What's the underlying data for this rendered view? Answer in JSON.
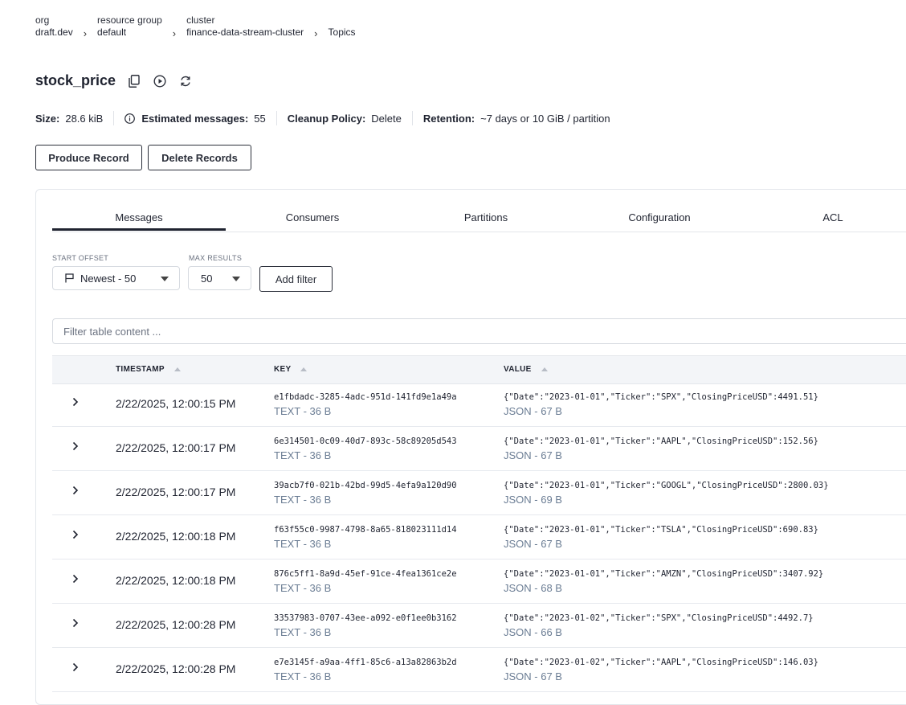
{
  "breadcrumb": {
    "segments": [
      {
        "label": "org",
        "value": "draft.dev"
      },
      {
        "label": "resource group",
        "value": "default"
      },
      {
        "label": "cluster",
        "value": "finance-data-stream-cluster"
      }
    ],
    "current": "Topics"
  },
  "topic": {
    "name": "stock_price",
    "icons": [
      "copy-icon",
      "play-icon",
      "refresh-icon"
    ]
  },
  "stats": {
    "size_label": "Size:",
    "size_value": "28.6 kiB",
    "messages_label": "Estimated messages:",
    "messages_value": "55",
    "cleanup_label": "Cleanup Policy:",
    "cleanup_value": "Delete",
    "retention_label": "Retention:",
    "retention_value": "~7 days or 10 GiB / partition"
  },
  "actions": {
    "produce": "Produce Record",
    "delete": "Delete Records"
  },
  "tabs": [
    {
      "label": "Messages",
      "active": true
    },
    {
      "label": "Consumers"
    },
    {
      "label": "Partitions"
    },
    {
      "label": "Configuration"
    },
    {
      "label": "ACL"
    }
  ],
  "filters": {
    "start_offset_label": "START OFFSET",
    "start_offset_value": "Newest - 50",
    "max_results_label": "MAX RESULTS",
    "max_results_value": "50",
    "add_filter": "Add filter"
  },
  "search": {
    "placeholder": "Filter table content ..."
  },
  "table": {
    "headers": {
      "timestamp": "TIMESTAMP",
      "key": "KEY",
      "value": "VALUE"
    },
    "rows": [
      {
        "timestamp": "2/22/2025, 12:00:15 PM",
        "key": "e1fbdadc-3285-4adc-951d-141fd9e1a49a",
        "key_meta": "TEXT - 36 B",
        "value": "{\"Date\":\"2023-01-01\",\"Ticker\":\"SPX\",\"ClosingPriceUSD\":4491.51}",
        "value_meta": "JSON - 67 B"
      },
      {
        "timestamp": "2/22/2025, 12:00:17 PM",
        "key": "6e314501-0c09-40d7-893c-58c89205d543",
        "key_meta": "TEXT - 36 B",
        "value": "{\"Date\":\"2023-01-01\",\"Ticker\":\"AAPL\",\"ClosingPriceUSD\":152.56}",
        "value_meta": "JSON - 67 B"
      },
      {
        "timestamp": "2/22/2025, 12:00:17 PM",
        "key": "39acb7f0-021b-42bd-99d5-4efa9a120d90",
        "key_meta": "TEXT - 36 B",
        "value": "{\"Date\":\"2023-01-01\",\"Ticker\":\"GOOGL\",\"ClosingPriceUSD\":2800.03}",
        "value_meta": "JSON - 69 B"
      },
      {
        "timestamp": "2/22/2025, 12:00:18 PM",
        "key": "f63f55c0-9987-4798-8a65-818023111d14",
        "key_meta": "TEXT - 36 B",
        "value": "{\"Date\":\"2023-01-01\",\"Ticker\":\"TSLA\",\"ClosingPriceUSD\":690.83}",
        "value_meta": "JSON - 67 B"
      },
      {
        "timestamp": "2/22/2025, 12:00:18 PM",
        "key": "876c5ff1-8a9d-45ef-91ce-4fea1361ce2e",
        "key_meta": "TEXT - 36 B",
        "value": "{\"Date\":\"2023-01-01\",\"Ticker\":\"AMZN\",\"ClosingPriceUSD\":3407.92}",
        "value_meta": "JSON - 68 B"
      },
      {
        "timestamp": "2/22/2025, 12:00:28 PM",
        "key": "33537983-0707-43ee-a092-e0f1ee0b3162",
        "key_meta": "TEXT - 36 B",
        "value": "{\"Date\":\"2023-01-02\",\"Ticker\":\"SPX\",\"ClosingPriceUSD\":4492.7}",
        "value_meta": "JSON - 66 B"
      },
      {
        "timestamp": "2/22/2025, 12:00:28 PM",
        "key": "e7e3145f-a9aa-4ff1-85c6-a13a82863b2d",
        "key_meta": "TEXT - 36 B",
        "value": "{\"Date\":\"2023-01-02\",\"Ticker\":\"AAPL\",\"ClosingPriceUSD\":146.03}",
        "value_meta": "JSON - 67 B"
      }
    ]
  }
}
